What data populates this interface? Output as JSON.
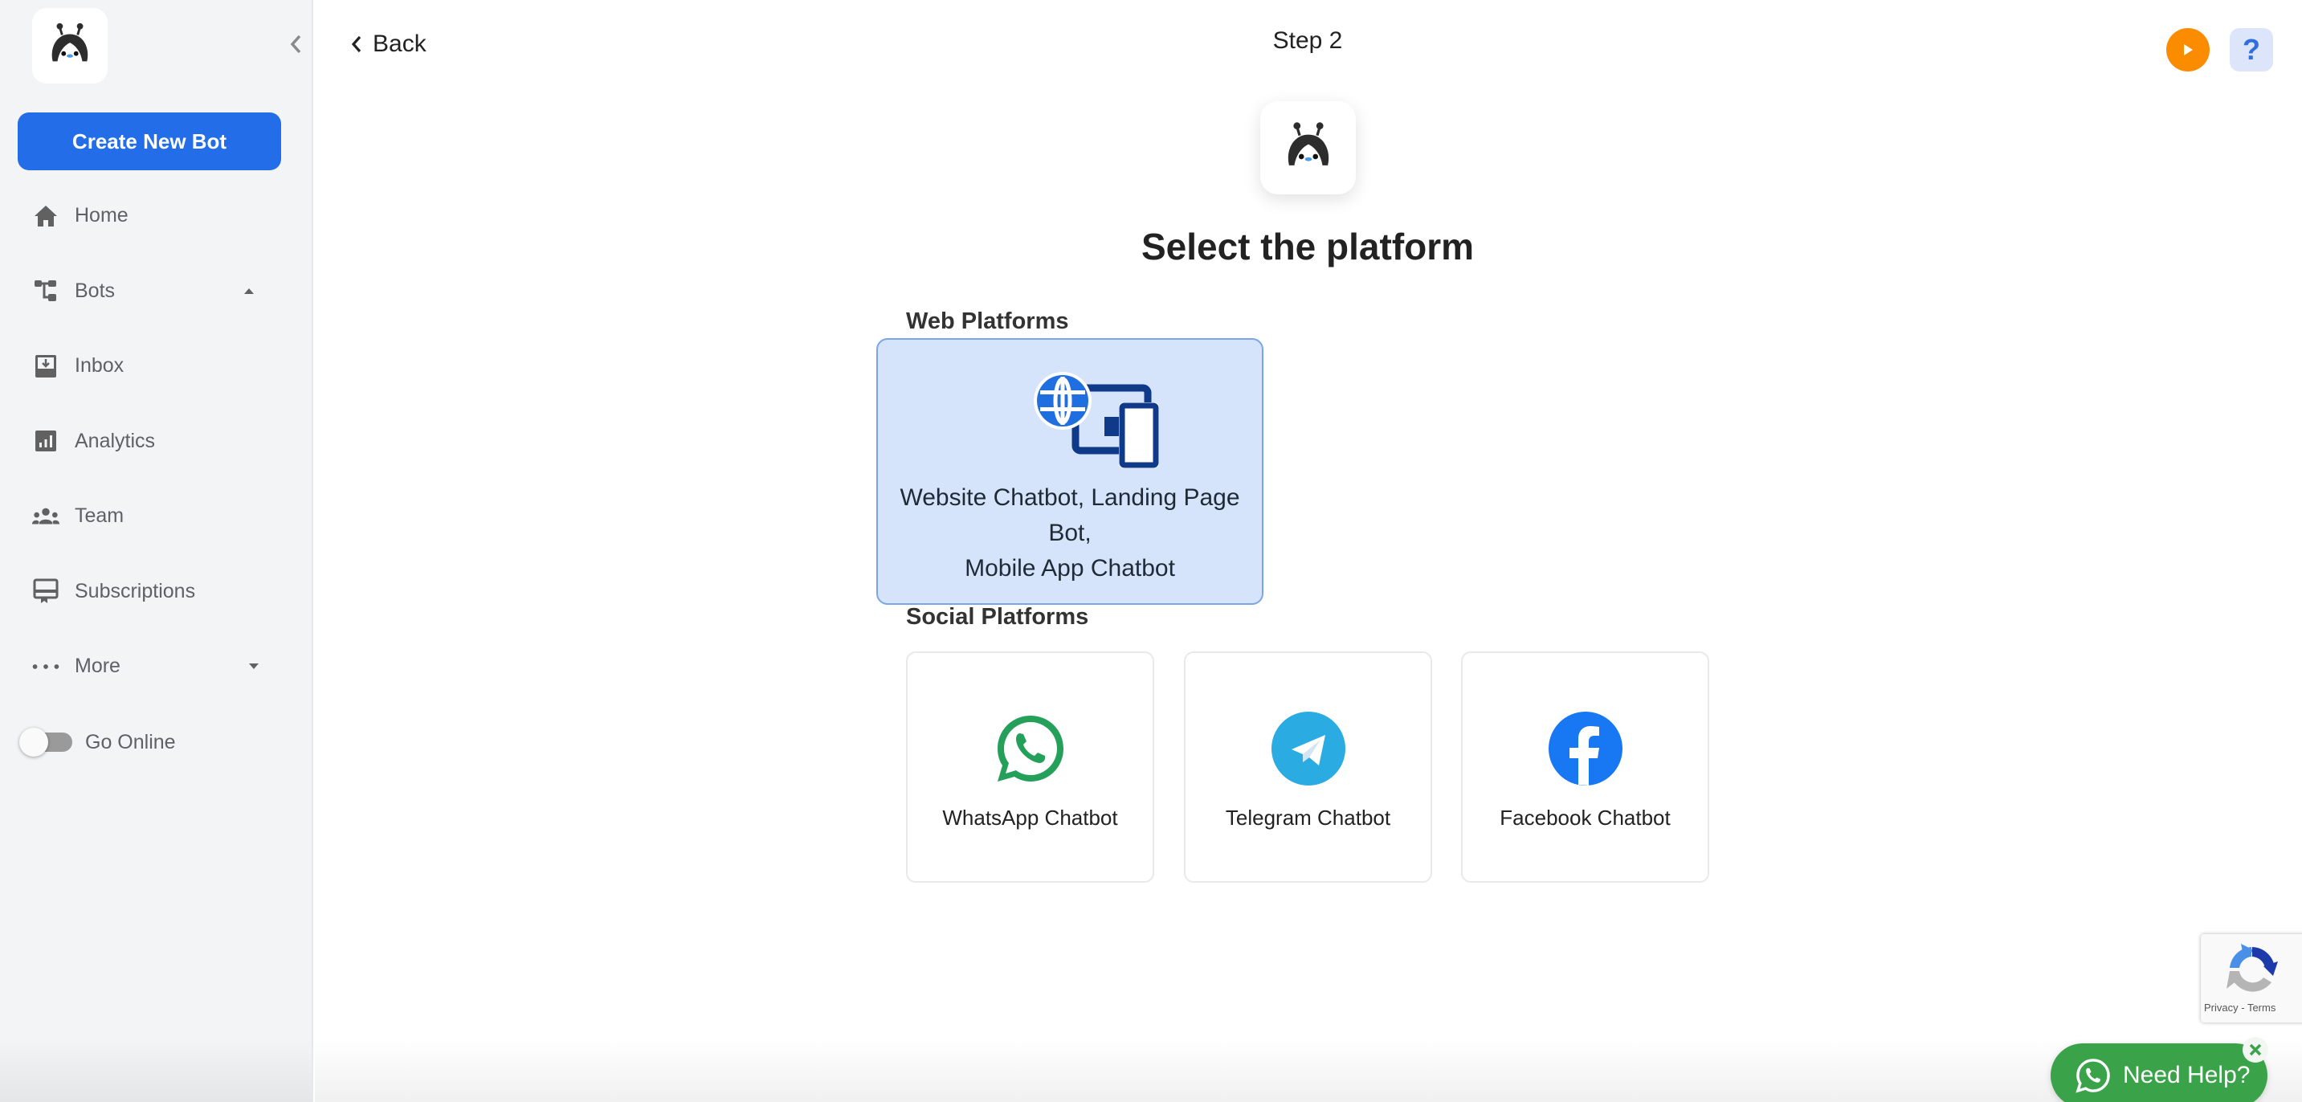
{
  "sidebar": {
    "create_button": "Create New Bot",
    "items": [
      {
        "label": "Home",
        "icon": "home-icon"
      },
      {
        "label": "Bots",
        "icon": "bots-icon",
        "caret": "up"
      },
      {
        "label": "Inbox",
        "icon": "inbox-icon"
      },
      {
        "label": "Analytics",
        "icon": "analytics-icon"
      },
      {
        "label": "Team",
        "icon": "team-icon"
      },
      {
        "label": "Subscriptions",
        "icon": "subscriptions-icon"
      },
      {
        "label": "More",
        "icon": "more-dots-icon",
        "caret": "down"
      }
    ],
    "toggle": {
      "label": "Go Online",
      "on": false
    }
  },
  "header": {
    "back_label": "Back",
    "step": "Step 2"
  },
  "main": {
    "title": "Select the platform",
    "web_section": {
      "label": "Web Platforms",
      "card": {
        "line1": "Website Chatbot, Landing Page Bot,",
        "line2": "Mobile App Chatbot",
        "selected": true
      }
    },
    "social_section": {
      "label": "Social Platforms",
      "cards": [
        {
          "label": "WhatsApp Chatbot",
          "icon": "whatsapp-icon",
          "color": "#25a05a"
        },
        {
          "label": "Telegram Chatbot",
          "icon": "telegram-icon",
          "color": "#2aabe2"
        },
        {
          "label": "Facebook Chatbot",
          "icon": "facebook-icon",
          "color": "#1877f2"
        }
      ]
    }
  },
  "widgets": {
    "recaptcha": {
      "privacy": "Privacy",
      "separator": " - ",
      "terms": "Terms"
    },
    "need_help": {
      "label": "Need Help?",
      "color": "#3aa34a"
    }
  },
  "colors": {
    "accent": "#236ee8",
    "sidebar_bg": "#f2f4f6",
    "selected_card_bg": "#d6e4fb",
    "play_button": "#fb8c00",
    "help_button_bg": "#dde5fa"
  }
}
